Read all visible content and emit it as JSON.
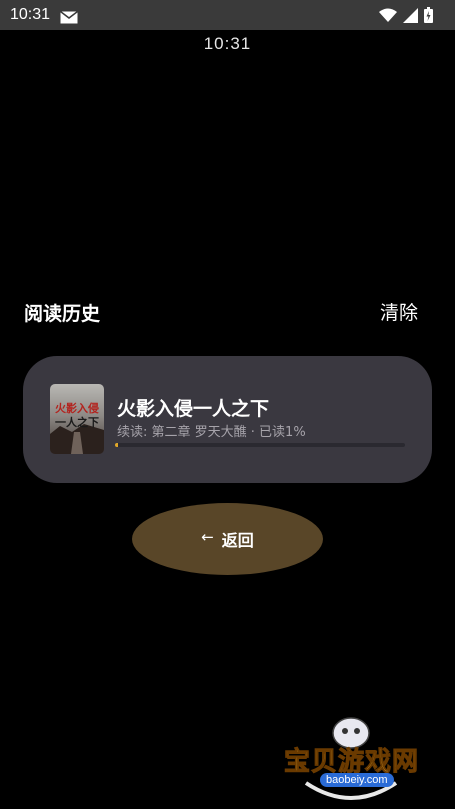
{
  "status_bar": {
    "time": "10:31",
    "icons": [
      "mail-icon",
      "wifi-icon",
      "signal-icon",
      "battery-icon"
    ]
  },
  "clock": {
    "time": "10:31"
  },
  "history": {
    "title": "阅读历史",
    "clear_label": "清除"
  },
  "books": [
    {
      "title": "火影入侵一人之下",
      "progress_text": "续读: 第二章 罗天大醮 · 已读1%",
      "progress_percent": 1,
      "cover_text": [
        "火影入侵",
        "一人之下"
      ]
    }
  ],
  "back_button": {
    "label": "返回",
    "icon": "arrow-left-icon"
  },
  "watermark": {
    "name": "宝贝游戏网",
    "domain": "baobeiy.com"
  },
  "colors": {
    "background": "#000000",
    "status_bar": "#3a3a3a",
    "card": "#3a3840",
    "back_button": "#594628",
    "progress_fill": "#e0a82a"
  }
}
